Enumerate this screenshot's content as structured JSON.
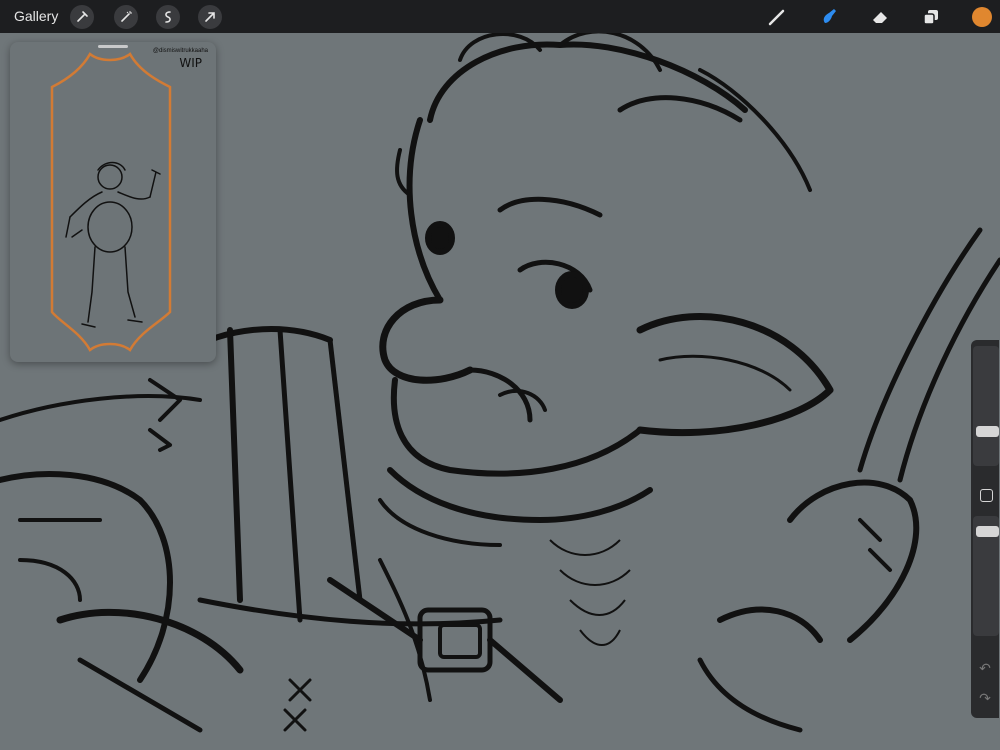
{
  "topbar": {
    "gallery_label": "Gallery",
    "left_tools": [
      "wrench-icon",
      "magic-wand-icon",
      "selection-icon",
      "transform-arrow-icon"
    ],
    "right_tools": [
      "brush-icon",
      "smudge-icon",
      "eraser-icon",
      "layers-icon"
    ],
    "active_tool": "smudge-icon",
    "current_color": "#e0872f"
  },
  "reference": {
    "tag_text": "@dismiswitrukkaaha",
    "wip_text": "WIP"
  },
  "sidebar": {
    "brush_size": 0.25,
    "opacity": 0.95
  },
  "colors": {
    "canvas": "#6f7679",
    "topbar": "#1d1e20",
    "accent": "#2d8cf0",
    "frame": "#d27b35"
  }
}
